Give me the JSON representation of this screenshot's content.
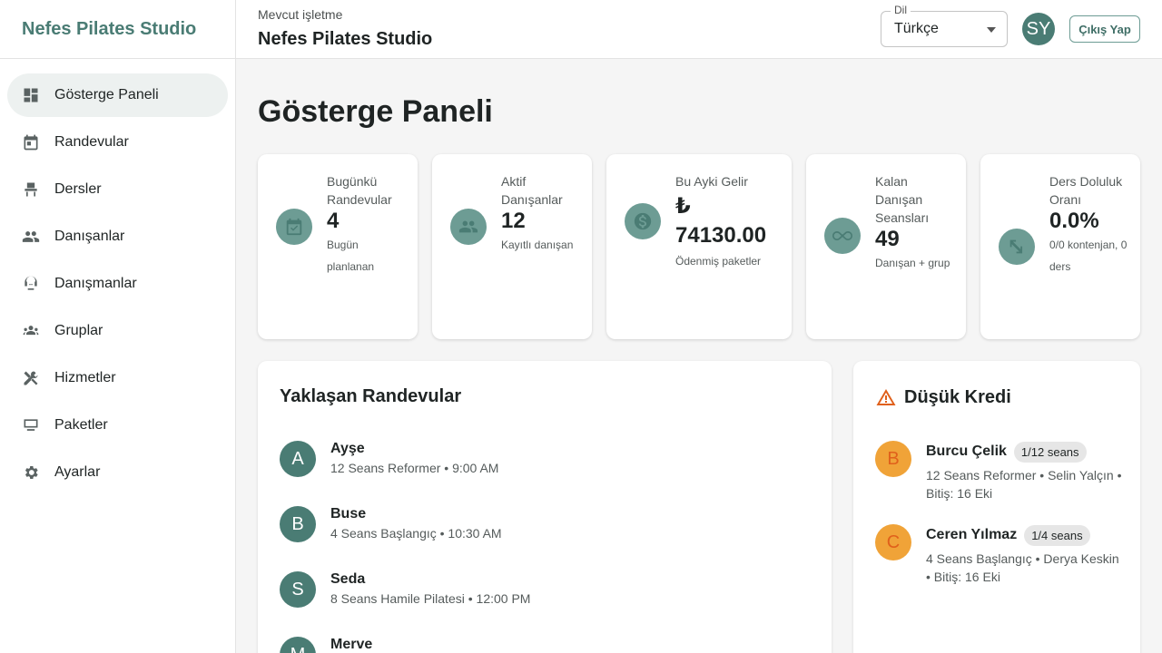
{
  "sidebar": {
    "brand": "Nefes Pilates Studio",
    "items": [
      {
        "label": "Gösterge Paneli",
        "icon": "dashboard-icon",
        "active": true
      },
      {
        "label": "Randevular",
        "icon": "calendar-icon"
      },
      {
        "label": "Dersler",
        "icon": "chair-icon"
      },
      {
        "label": "Danışanlar",
        "icon": "people-icon"
      },
      {
        "label": "Danışmanlar",
        "icon": "support-agent-icon"
      },
      {
        "label": "Gruplar",
        "icon": "groups-icon"
      },
      {
        "label": "Hizmetler",
        "icon": "tools-icon"
      },
      {
        "label": "Paketler",
        "icon": "package-icon"
      },
      {
        "label": "Ayarlar",
        "icon": "gear-icon"
      }
    ]
  },
  "header": {
    "business_caption": "Mevcut işletme",
    "business_name": "Nefes Pilates Studio",
    "language_legend": "Dil",
    "language_value": "Türkçe",
    "avatar_initials": "SY",
    "logout_label": "Çıkış Yap"
  },
  "main": {
    "title": "Gösterge Paneli",
    "stats": [
      {
        "label": "Bugünkü Randevular",
        "value": "4",
        "sub": "Bugün planlanan",
        "icon": "calendar-check-icon"
      },
      {
        "label": "Aktif Danışanlar",
        "value": "12",
        "sub": "Kayıtlı danışan",
        "icon": "people-icon"
      },
      {
        "label": "Bu Ayki Gelir",
        "value": "₺ 74130.00",
        "sub": "Ödenmiş paketler",
        "icon": "dollar-icon"
      },
      {
        "label": "Kalan Danışan Seansları",
        "value": "49",
        "sub": "Danışan + grup",
        "icon": "infinity-icon"
      },
      {
        "label": "Ders Doluluk Oranı",
        "value": "0.0%",
        "sub": "0/0 kontenjan, 0 ders",
        "icon": "expand-icon"
      }
    ],
    "upcoming": {
      "title": "Yaklaşan Randevular",
      "items": [
        {
          "initial": "A",
          "name": "Ayşe",
          "detail": "12 Seans Reformer • 9:00 AM"
        },
        {
          "initial": "B",
          "name": "Buse",
          "detail": "4 Seans Başlangıç • 10:30 AM"
        },
        {
          "initial": "S",
          "name": "Seda",
          "detail": "8 Seans Hamile Pilatesi • 12:00 PM"
        },
        {
          "initial": "M",
          "name": "Merve",
          "detail": ""
        }
      ]
    },
    "low_credit": {
      "title": "Düşük Kredi",
      "icon": "warning-icon",
      "items": [
        {
          "initial": "B",
          "name": "Burcu Çelik",
          "badge": "1/12 seans",
          "detail": "12 Seans Reformer • Selin Yalçın • Bitiş: 16 Eki"
        },
        {
          "initial": "C",
          "name": "Ceren Yılmaz",
          "badge": "1/4 seans",
          "detail": "4 Seans Başlangıç • Derya Keskin • Bitiş: 16 Eki"
        }
      ]
    }
  },
  "colors": {
    "brand": "#4a7c74",
    "icon_circle": "#6d9c94",
    "warning": "#e0601b",
    "credit_avatar": "#f0a338"
  }
}
